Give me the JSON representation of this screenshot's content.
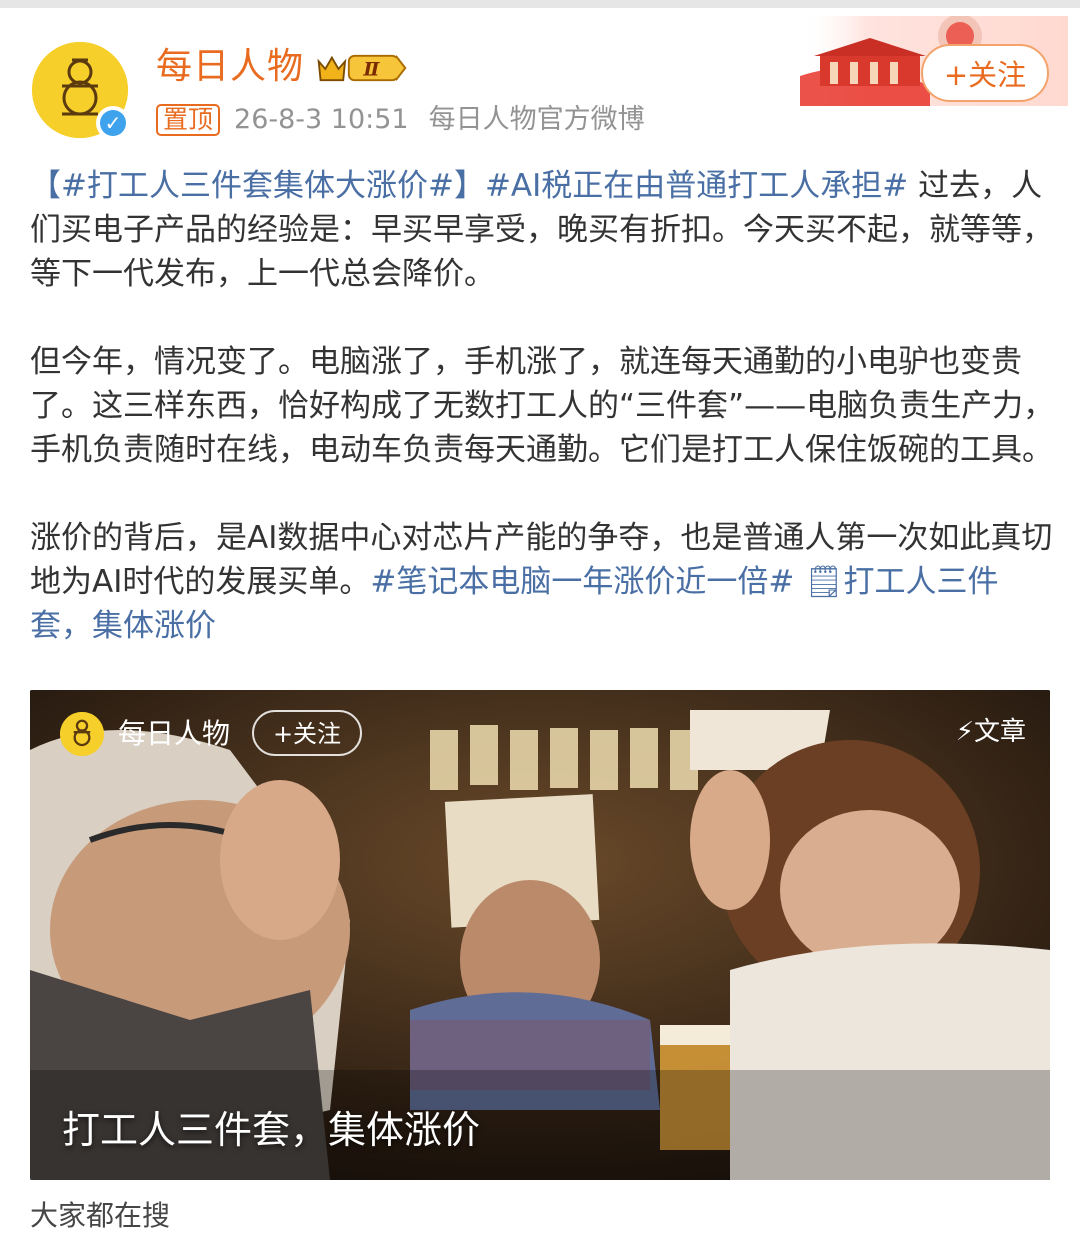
{
  "header": {
    "account_name": "每日人物",
    "vip_level": "Ⅱ",
    "pin_label": "置顶",
    "timestamp": "26-8-3 10:51",
    "source": "每日人物官方微博",
    "follow_label": "+关注"
  },
  "post": {
    "p1": {
      "tag1": "【#打工人三件套集体大涨价#】",
      "tag2": "#AI税正在由普通打工人承担#",
      "text": " 过去，人们买电子产品的经验是：早买早享受，晚买有折扣。今天买不起，就等等，等下一代发布，上一代总会降价。"
    },
    "p2": "但今年，情况变了。电脑涨了，手机涨了，就连每天通勤的小电驴也变贵了。这三样东西，恰好构成了无数打工人的“三件套”——电脑负责生产力，手机负责随时在线，电动车负责每天通勤。它们是打工人保住饭碗的工具。",
    "p3": {
      "text": "涨价的背后，是AI数据中心对芯片产能的争夺，也是普通人第一次如此真切地为AI时代的发展买单。",
      "tag3": "#笔记本电脑一年涨价近一倍#",
      "link": " 🗒打工人三件套，集体涨价"
    }
  },
  "media": {
    "account_name": "每日人物",
    "follow_label": "+关注",
    "type_label": "文章",
    "caption": "打工人三件套，集体涨价"
  },
  "footer": {
    "partial_text": "大家都在搜"
  },
  "colors": {
    "accent": "#e86b1f",
    "tag": "#4a6fa5",
    "meta": "#939393",
    "verified": "#3ea3ec"
  }
}
